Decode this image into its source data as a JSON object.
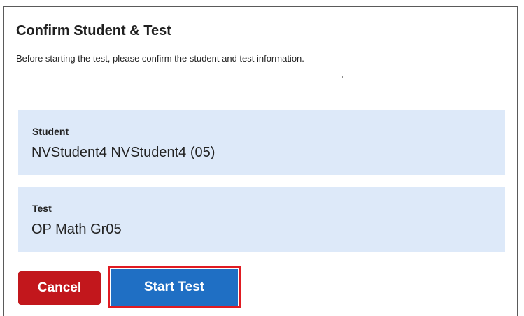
{
  "dialog": {
    "title": "Confirm Student & Test",
    "instructions": "Before starting the test, please confirm the student and test information."
  },
  "student": {
    "label": "Student",
    "value": "NVStudent4 NVStudent4 (05)"
  },
  "test": {
    "label": "Test",
    "value": "OP Math Gr05"
  },
  "buttons": {
    "cancel_label": "Cancel",
    "start_label": "Start Test"
  },
  "colors": {
    "panel_background": "#dde9f9",
    "cancel_button": "#c2171c",
    "start_button": "#1f6fc4",
    "highlight_outline": "#e01b22"
  }
}
